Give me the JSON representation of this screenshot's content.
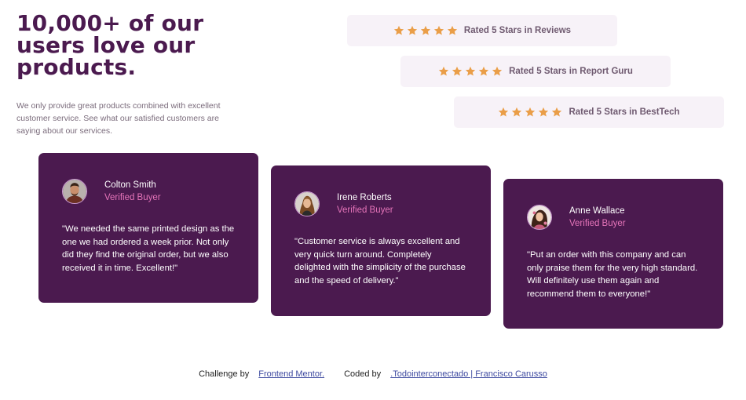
{
  "hero": {
    "title": "10,000+ of our users love our products.",
    "description": "We only provide great products combined with excellent customer service. See what our satisfied customers are saying about our services."
  },
  "ratings": [
    {
      "label": "Rated 5 Stars in Reviews",
      "stars": 5
    },
    {
      "label": "Rated 5 Stars in Report Guru",
      "stars": 5
    },
    {
      "label": "Rated 5 Stars in BestTech",
      "stars": 5
    }
  ],
  "testimonials": [
    {
      "name": "Colton Smith",
      "status": "Verified Buyer",
      "quote": "\"We needed the same printed design as the one we had ordered a week prior. Not only did they find the original order, but we also received it in time. Excellent!\""
    },
    {
      "name": "Irene Roberts",
      "status": "Verified Buyer",
      "quote": "\"Customer service is always excellent and very quick turn around. Completely delighted with the simplicity of the purchase and the speed of delivery.\""
    },
    {
      "name": "Anne Wallace",
      "status": "Verified Buyer",
      "quote": "\"Put an order with this company and can only praise them for the very high standard. Will definitely use them again and recommend them to everyone!\""
    }
  ],
  "footer": {
    "challenge_prefix": "Challenge by",
    "challenge_link": "Frontend Mentor.",
    "coded_prefix": "Coded by",
    "coded_link": ".Todointerconectado | Francisco Carusso"
  },
  "colors": {
    "primary": "#4b1a4f",
    "accent_pink": "#e574b9",
    "star": "#ea9e48",
    "rating_bg": "#f7f2f8"
  },
  "icons": [
    "star-icon",
    "avatar-colton",
    "avatar-irene",
    "avatar-anne"
  ]
}
